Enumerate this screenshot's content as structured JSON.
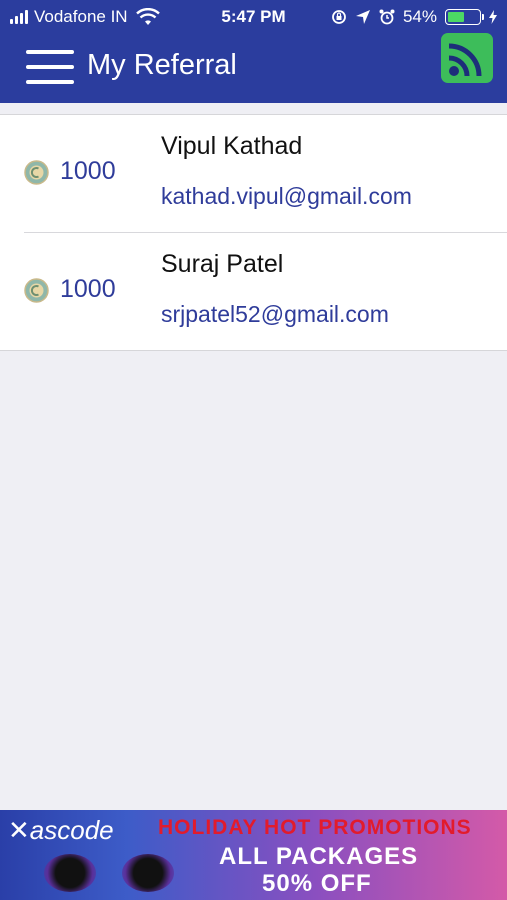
{
  "status_bar": {
    "carrier": "Vodafone IN",
    "time": "5:47 PM",
    "battery_percent": "54%",
    "battery_level": 0.54,
    "icons": [
      "signal-icon",
      "wifi-icon",
      "rotation-lock-icon",
      "location-icon",
      "alarm-icon",
      "battery-icon",
      "charging-icon"
    ]
  },
  "header": {
    "title": "My Referral",
    "menu_icon": "hamburger-menu-icon",
    "action_icon": "rss-feed-icon",
    "background": "#2b3d9e",
    "action_color": "#3dbd5a"
  },
  "referrals": [
    {
      "points": "1000",
      "name": "Vipul Kathad",
      "email": "kathad.vipul@gmail.com"
    },
    {
      "points": "1000",
      "name": "Suraj Patel",
      "email": "srjpatel52@gmail.com"
    }
  ],
  "banner": {
    "brand": "ascode",
    "line1": "HOLIDAY HOT PROMOTIONS",
    "line2": "ALL PACKAGES",
    "line3": "50% OFF"
  },
  "colors": {
    "accent_text": "#2f3c9a",
    "promo_red": "#e21b2c"
  }
}
